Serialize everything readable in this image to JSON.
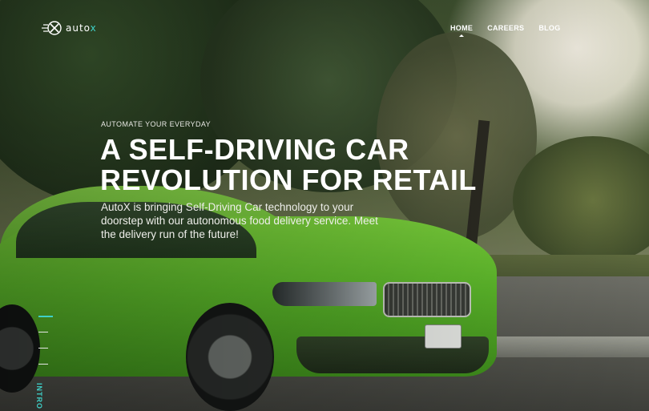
{
  "header": {
    "logo_text": "auto",
    "logo_accent": "x",
    "nav": [
      {
        "label": "HOME",
        "active": true
      },
      {
        "label": "CAREERS",
        "active": false
      },
      {
        "label": "BLOG",
        "active": false
      }
    ]
  },
  "hero": {
    "eyebrow": "AUTOMATE YOUR EVERYDAY",
    "headline_line1": "A SELF-DRIVING CAR",
    "headline_line2": "REVOLUTION FOR RETAIL",
    "subtext": "AutoX is bringing Self-Driving Car technology to your doorstep with our autonomous food delivery service. Meet the delivery run of the future!"
  },
  "side_nav": {
    "section_label": "INTRO"
  },
  "colors": {
    "accent": "#3fd0c8",
    "text": "#ffffff"
  }
}
